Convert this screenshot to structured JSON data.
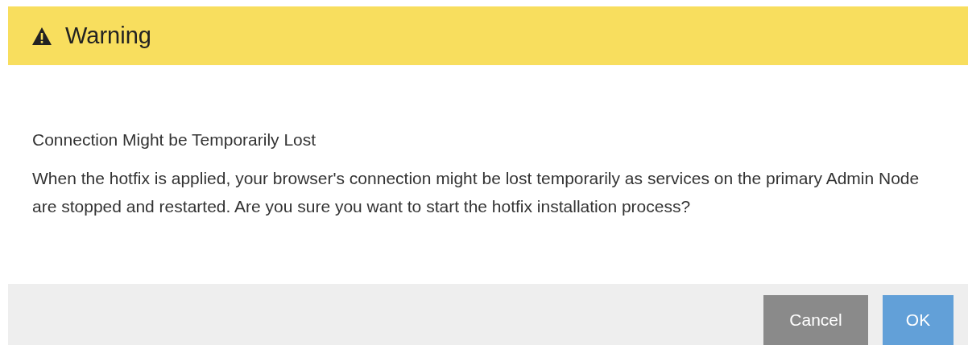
{
  "dialog": {
    "title": "Warning",
    "heading": "Connection Might be Temporarily Lost",
    "message": "When the hotfix is applied, your browser's connection might be lost temporarily as services on the primary Admin Node are stopped and restarted. Are you sure you want to start the hotfix installation process?",
    "buttons": [
      {
        "label": "Cancel",
        "kind": "secondary"
      },
      {
        "label": "OK",
        "kind": "primary"
      }
    ]
  }
}
